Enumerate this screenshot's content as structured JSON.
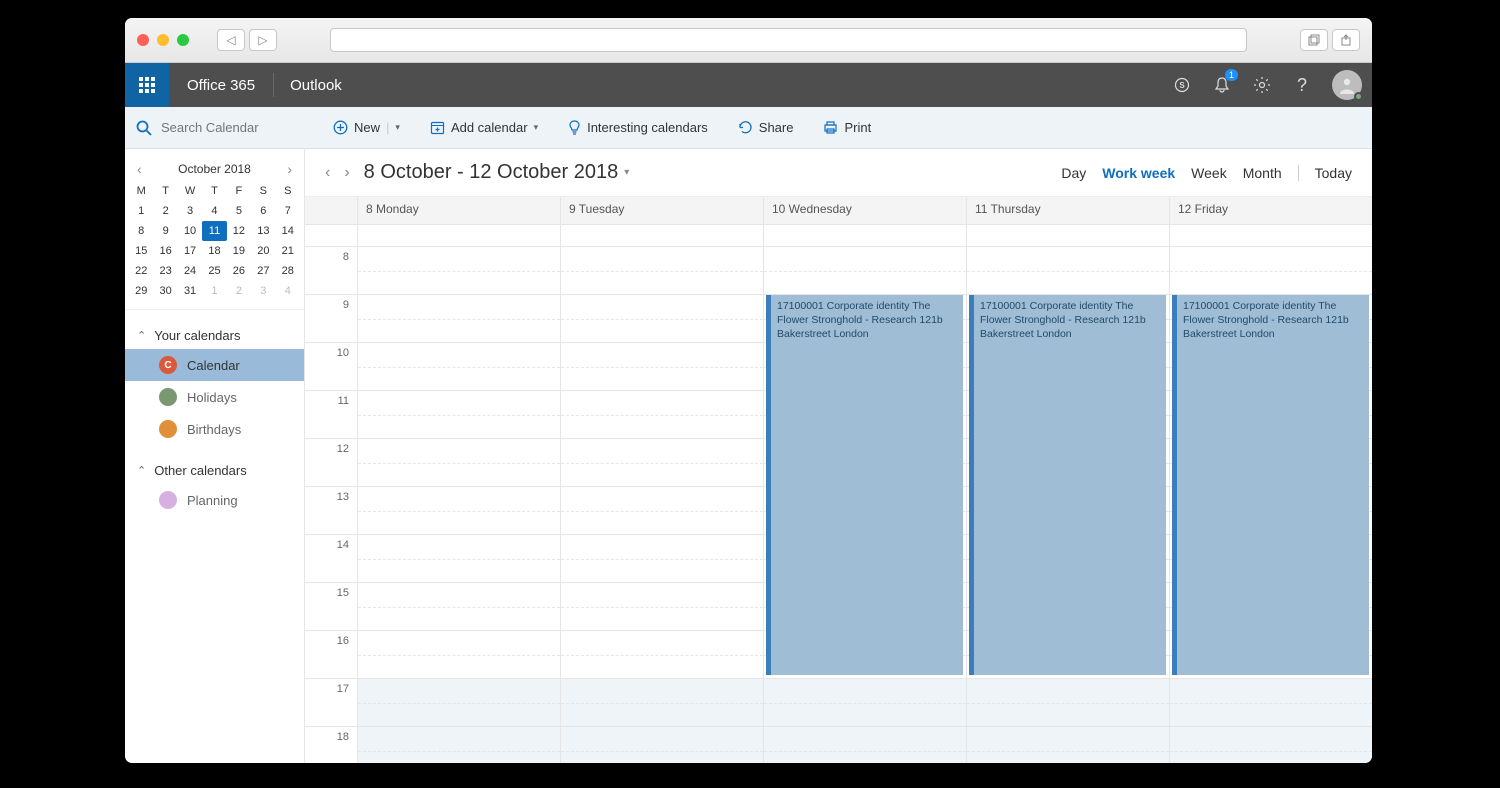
{
  "o365": {
    "brand": "Office 365",
    "app": "Outlook",
    "notification_count": "1"
  },
  "search": {
    "placeholder": "Search Calendar"
  },
  "commands": {
    "new": "New",
    "add_calendar": "Add calendar",
    "interesting": "Interesting calendars",
    "share": "Share",
    "print": "Print"
  },
  "minical": {
    "title": "October 2018",
    "dows": [
      "M",
      "T",
      "W",
      "T",
      "F",
      "S",
      "S"
    ],
    "weeks": [
      [
        {
          "n": "1"
        },
        {
          "n": "2"
        },
        {
          "n": "3"
        },
        {
          "n": "4"
        },
        {
          "n": "5"
        },
        {
          "n": "6"
        },
        {
          "n": "7"
        }
      ],
      [
        {
          "n": "8"
        },
        {
          "n": "9"
        },
        {
          "n": "10"
        },
        {
          "n": "11",
          "sel": true
        },
        {
          "n": "12"
        },
        {
          "n": "13"
        },
        {
          "n": "14"
        }
      ],
      [
        {
          "n": "15"
        },
        {
          "n": "16"
        },
        {
          "n": "17"
        },
        {
          "n": "18"
        },
        {
          "n": "19"
        },
        {
          "n": "20"
        },
        {
          "n": "21"
        }
      ],
      [
        {
          "n": "22"
        },
        {
          "n": "23"
        },
        {
          "n": "24"
        },
        {
          "n": "25"
        },
        {
          "n": "26"
        },
        {
          "n": "27"
        },
        {
          "n": "28"
        }
      ],
      [
        {
          "n": "29"
        },
        {
          "n": "30"
        },
        {
          "n": "31"
        },
        {
          "n": "1",
          "dim": true
        },
        {
          "n": "2",
          "dim": true
        },
        {
          "n": "3",
          "dim": true
        },
        {
          "n": "4",
          "dim": true
        }
      ]
    ]
  },
  "sidebar": {
    "your_calendars": "Your calendars",
    "other_calendars": "Other calendars",
    "items": [
      {
        "label": "Calendar",
        "color": "#d9593d",
        "active": true,
        "initial": "C"
      },
      {
        "label": "Holidays",
        "color": "#7a9972"
      },
      {
        "label": "Birthdays",
        "color": "#e08f3a"
      }
    ],
    "other_items": [
      {
        "label": "Planning",
        "color": "#d6b0e0"
      }
    ]
  },
  "surface": {
    "range": "8 October - 12 October 2018",
    "views": {
      "day": "Day",
      "work_week": "Work week",
      "week": "Week",
      "month": "Month",
      "today": "Today"
    },
    "active_view": "work_week",
    "days": [
      "8 Monday",
      "9 Tuesday",
      "10 Wednesday",
      "11 Thursday",
      "12 Friday"
    ],
    "hours": [
      "8",
      "9",
      "10",
      "11",
      "12",
      "13",
      "14",
      "15",
      "16",
      "17",
      "18"
    ],
    "off_start_index": 9,
    "event_text": "17100001 Corporate identity The Flower Stronghold - Research 121b Bakerstreet London",
    "event_days": [
      2,
      3,
      4
    ],
    "event_top_hour_index": 1,
    "event_span_hours": 8
  }
}
